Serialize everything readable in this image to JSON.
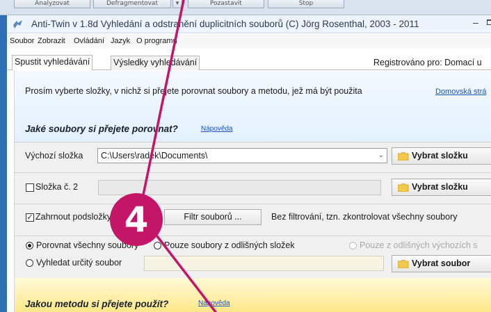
{
  "background_window": {
    "buttons": [
      "Analyzovat",
      "Defragmentovat",
      "▾",
      "Pozastavit",
      "Stop"
    ]
  },
  "window": {
    "title": "Anti-Twin  v 1.8d   Vyhledání a odstranění duplicitních souborů   (C) Jörg Rosenthal, 2003 - 2011",
    "min_glyph": "–",
    "frame_color": "#2f6fb5"
  },
  "menu": {
    "items": [
      "Soubor",
      "Zobrazit",
      "Ovládání",
      "Jazyk",
      "O programu"
    ]
  },
  "tabs": {
    "items": [
      {
        "label": "Spustit vyhledávání",
        "active": true
      },
      {
        "label": "Výsledky vyhledávání",
        "active": false
      }
    ],
    "registered": "Registrováno pro: Domací u"
  },
  "intro": {
    "instruction": "Prosím vyberte složky, v nichž si přejete porovnat soubory a metodu, jež má být použita",
    "home_link": "Domovská strá"
  },
  "files_section": {
    "question": "Jaké soubory si přejete porovnat?",
    "help_link": "Nápověda"
  },
  "source_folder": {
    "label": "Výchozí složka",
    "value": "C:\\Users\\radek\\Documents\\",
    "dropdown_glyph": "⌄",
    "button_label": "Vybrat složku"
  },
  "folder2": {
    "label": "Složka č. 2",
    "checked": false,
    "button_label": "Vybrat složku"
  },
  "subfolders": {
    "label": "Zahrnout podsložky",
    "checked": true,
    "filter_button": "Filtr souborů ...",
    "filter_text": "Bez filtrování, tzn. zkontrolovat všechny soubory"
  },
  "compare": {
    "options": [
      {
        "label": "Porovnat všechny soubory",
        "selected": true,
        "enabled": true
      },
      {
        "label": "Pouze soubory z odlišných složek",
        "selected": false,
        "enabled": true
      },
      {
        "label": "Pouze z odlišných výchozích s",
        "selected": false,
        "enabled": false
      }
    ],
    "specific": {
      "label": "Vyhledat určitý soubor",
      "selected": false,
      "button_label": "Vybrat soubor"
    }
  },
  "method_section": {
    "question": "Jakou metodu si přejete použít?",
    "help_link": "Nápověda"
  },
  "callout": {
    "number": "4",
    "color": "#c31669"
  },
  "colors": {
    "link": "#1a56b8",
    "blue_panel": "#e3f0fd",
    "yellow_panel": "#ffe88a",
    "folder_icon": "#f2c94c"
  }
}
